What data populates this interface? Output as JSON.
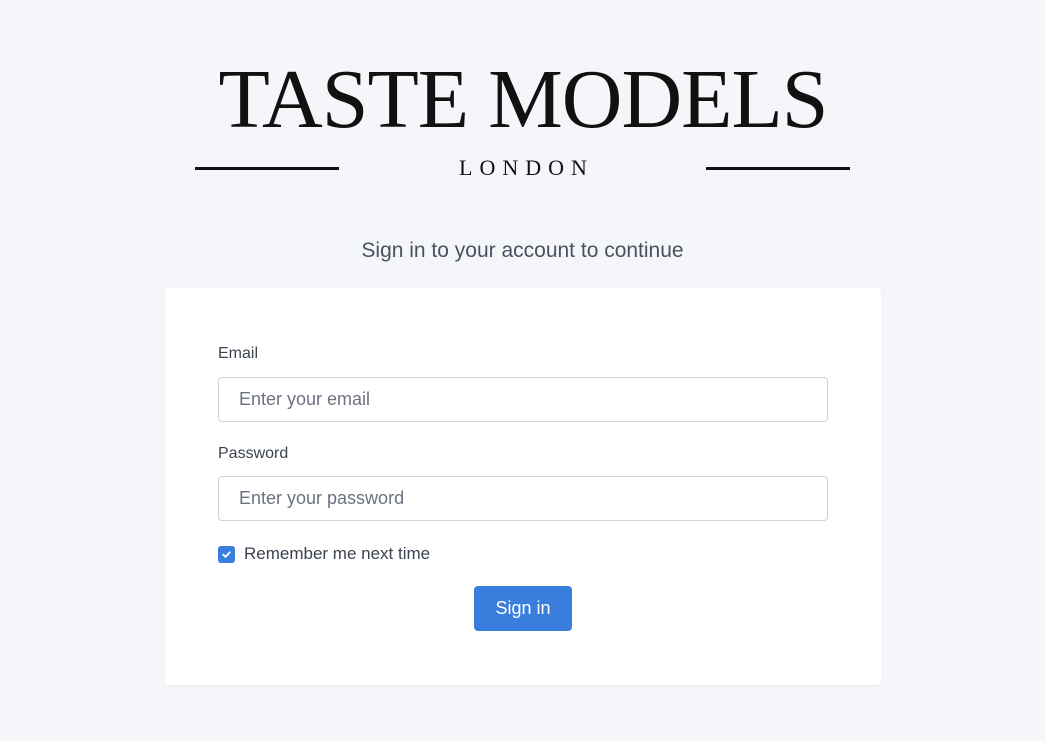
{
  "logo": {
    "title": "TASTE MODELS",
    "subtitle": "LONDON"
  },
  "page": {
    "subtitle": "Sign in to your account to continue"
  },
  "form": {
    "email": {
      "label": "Email",
      "placeholder": "Enter your email",
      "value": ""
    },
    "password": {
      "label": "Password",
      "placeholder": "Enter your password",
      "value": ""
    },
    "remember": {
      "label": "Remember me next time",
      "checked": true,
      "icon": "check-icon"
    },
    "submit_label": "Sign in"
  },
  "colors": {
    "background": "#f5f6fa",
    "card": "#ffffff",
    "accent": "#3b7ddd",
    "text": "#333b47",
    "logo": "#111111"
  }
}
